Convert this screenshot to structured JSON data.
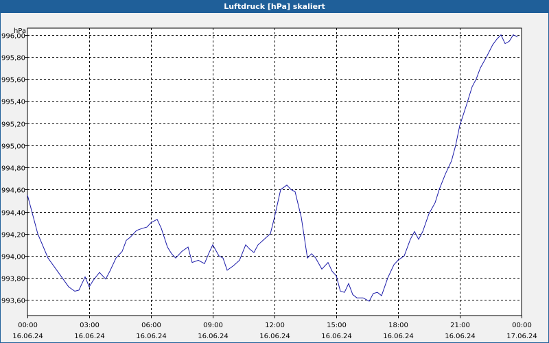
{
  "chart_data": {
    "type": "line",
    "title": "Luftdruck [hPa] skaliert",
    "ylabel": "hPa",
    "xlabel": "",
    "ylim": [
      993.46,
      996.06
    ],
    "xlim": [
      0,
      24
    ],
    "grid": true,
    "yticks": [
      {
        "value": 993.6,
        "label": "993,60"
      },
      {
        "value": 993.8,
        "label": "993,80"
      },
      {
        "value": 994.0,
        "label": "994,00"
      },
      {
        "value": 994.2,
        "label": "994,20"
      },
      {
        "value": 994.4,
        "label": "994,40"
      },
      {
        "value": 994.6,
        "label": "994,60"
      },
      {
        "value": 994.8,
        "label": "994,80"
      },
      {
        "value": 995.0,
        "label": "995,00"
      },
      {
        "value": 995.2,
        "label": "995,20"
      },
      {
        "value": 995.4,
        "label": "995,40"
      },
      {
        "value": 995.6,
        "label": "995,60"
      },
      {
        "value": 995.8,
        "label": "995,80"
      },
      {
        "value": 996.0,
        "label": "996,00"
      }
    ],
    "xticks": [
      {
        "value": 0,
        "time": "00:00",
        "date": "16.06.24"
      },
      {
        "value": 3,
        "time": "03:00",
        "date": "16.06.24"
      },
      {
        "value": 6,
        "time": "06:00",
        "date": "16.06.24"
      },
      {
        "value": 9,
        "time": "09:00",
        "date": "16.06.24"
      },
      {
        "value": 12,
        "time": "12:00",
        "date": "16.06.24"
      },
      {
        "value": 15,
        "time": "15:00",
        "date": "16.06.24"
      },
      {
        "value": 18,
        "time": "18:00",
        "date": "16.06.24"
      },
      {
        "value": 21,
        "time": "21:00",
        "date": "16.06.24"
      },
      {
        "value": 24,
        "time": "00:00",
        "date": "17.06.24"
      }
    ],
    "series": [
      {
        "color": "#1a1aa8",
        "x": [
          0.0,
          0.5,
          1.0,
          1.5,
          2.0,
          2.3,
          2.5,
          2.8,
          3.0,
          3.2,
          3.5,
          3.8,
          4.0,
          4.3,
          4.6,
          4.8,
          5.0,
          5.3,
          5.6,
          5.8,
          6.0,
          6.3,
          6.5,
          6.8,
          7.0,
          7.2,
          7.5,
          7.8,
          8.0,
          8.3,
          8.6,
          8.8,
          9.0,
          9.3,
          9.5,
          9.7,
          10.0,
          10.3,
          10.6,
          10.8,
          11.0,
          11.2,
          11.5,
          11.8,
          12.0,
          12.3,
          12.6,
          12.8,
          13.0,
          13.3,
          13.6,
          13.8,
          14.0,
          14.3,
          14.6,
          14.8,
          15.0,
          15.2,
          15.4,
          15.6,
          15.8,
          16.0,
          16.3,
          16.6,
          16.8,
          17.0,
          17.2,
          17.5,
          17.8,
          18.0,
          18.3,
          18.6,
          18.8,
          19.0,
          19.2,
          19.5,
          19.8,
          20.0,
          20.3,
          20.6,
          20.8,
          21.0,
          21.3,
          21.6,
          21.8,
          22.0,
          22.3,
          22.6,
          22.8,
          23.0,
          23.2,
          23.4,
          23.6,
          23.8
        ],
        "values": [
          994.55,
          994.2,
          993.98,
          993.85,
          993.72,
          993.68,
          993.69,
          993.81,
          993.72,
          993.78,
          993.85,
          993.79,
          993.86,
          993.98,
          994.04,
          994.14,
          994.17,
          994.23,
          994.25,
          994.26,
          994.3,
          994.33,
          994.25,
          994.08,
          994.02,
          993.98,
          994.04,
          994.08,
          993.94,
          993.96,
          993.93,
          994.02,
          994.1,
          994.0,
          993.98,
          993.87,
          993.91,
          993.96,
          994.1,
          994.06,
          994.03,
          994.1,
          994.15,
          994.2,
          994.35,
          994.6,
          994.64,
          994.6,
          994.58,
          994.35,
          993.98,
          994.02,
          993.98,
          993.88,
          993.94,
          993.86,
          993.82,
          993.68,
          993.67,
          993.75,
          993.65,
          993.62,
          993.62,
          993.59,
          993.66,
          993.67,
          993.64,
          993.8,
          993.92,
          993.96,
          994.0,
          994.15,
          994.22,
          994.15,
          994.22,
          994.38,
          994.48,
          994.6,
          994.74,
          994.86,
          995.0,
          995.18,
          995.35,
          995.53,
          995.6,
          995.7,
          995.8,
          995.91,
          995.96,
          996.0,
          995.92,
          995.94,
          996.0,
          995.98
        ]
      }
    ]
  }
}
